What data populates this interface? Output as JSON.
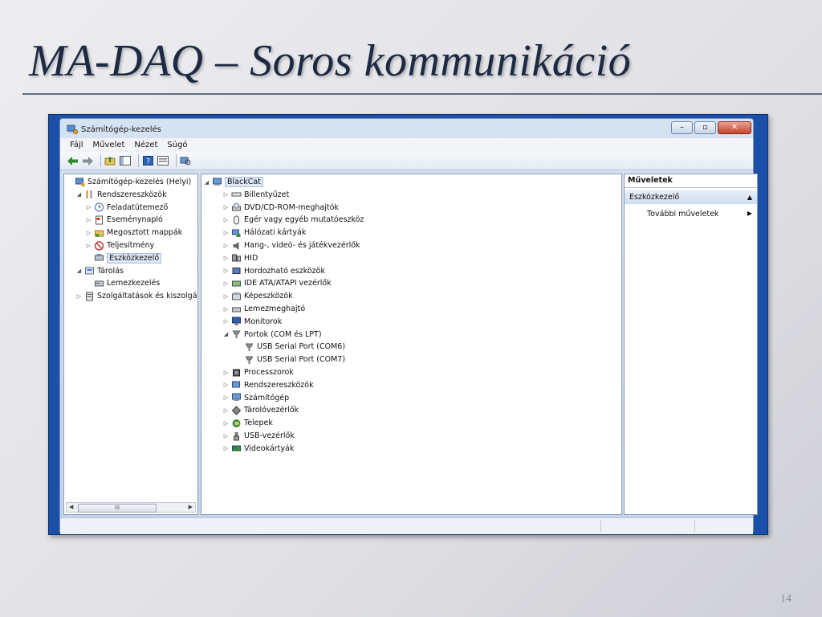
{
  "slide": {
    "title": "MA-DAQ – Soros kommunikáció",
    "page_number": "14"
  },
  "window": {
    "title": "Számítógép-kezelés",
    "buttons": {
      "minimize_icon": "minimize-icon",
      "maximize_icon": "maximize-icon",
      "close_icon": "close-icon"
    }
  },
  "menu": {
    "items": [
      "Fájl",
      "Művelet",
      "Nézet",
      "Súgó"
    ]
  },
  "toolbar": {
    "icons": [
      "back-arrow-icon",
      "forward-arrow-icon",
      "folder-up-icon",
      "console-tree-icon",
      "help-icon",
      "properties-icon",
      "scan-hardware-icon"
    ]
  },
  "left_tree": {
    "items": [
      {
        "label": "Számítógép-kezelés (Helyi)",
        "level": 0,
        "expander": "",
        "icon": "computer-management-icon"
      },
      {
        "label": "Rendszereszközök",
        "level": 1,
        "expander": "expanded",
        "icon": "tools-icon"
      },
      {
        "label": "Feladatütemező",
        "level": 2,
        "expander": "collapsed",
        "icon": "clock-icon"
      },
      {
        "label": "Eseménynapló",
        "level": 2,
        "expander": "collapsed",
        "icon": "event-log-icon"
      },
      {
        "label": "Megosztott mappák",
        "level": 2,
        "expander": "collapsed",
        "icon": "shared-folder-icon"
      },
      {
        "label": "Teljesítmény",
        "level": 2,
        "expander": "collapsed",
        "icon": "performance-icon"
      },
      {
        "label": "Eszközkezelő",
        "level": 2,
        "expander": "",
        "icon": "device-manager-icon",
        "selected": true
      },
      {
        "label": "Tárolás",
        "level": 1,
        "expander": "expanded",
        "icon": "storage-icon"
      },
      {
        "label": "Lemezkezelés",
        "level": 2,
        "expander": "",
        "icon": "disk-management-icon"
      },
      {
        "label": "Szolgáltatások és kiszolgáló",
        "level": 1,
        "expander": "collapsed",
        "icon": "services-icon"
      }
    ]
  },
  "device_tree": {
    "root": {
      "label": "BlackCat",
      "icon": "computer-icon"
    },
    "items": [
      {
        "label": "Billentyűzet",
        "level": 1,
        "expander": "collapsed",
        "icon": "keyboard-icon"
      },
      {
        "label": "DVD/CD-ROM-meghajtók",
        "level": 1,
        "expander": "collapsed",
        "icon": "dvd-drive-icon"
      },
      {
        "label": "Egér vagy egyéb mutatóeszköz",
        "level": 1,
        "expander": "collapsed",
        "icon": "mouse-icon"
      },
      {
        "label": "Hálózati kártyák",
        "level": 1,
        "expander": "collapsed",
        "icon": "network-adapter-icon"
      },
      {
        "label": "Hang-, videó- és játékvezérlők",
        "level": 1,
        "expander": "collapsed",
        "icon": "speaker-icon"
      },
      {
        "label": "HID",
        "level": 1,
        "expander": "collapsed",
        "icon": "hid-icon"
      },
      {
        "label": "Hordozható eszközök",
        "level": 1,
        "expander": "collapsed",
        "icon": "portable-device-icon"
      },
      {
        "label": "IDE ATA/ATAPI vezérlők",
        "level": 1,
        "expander": "collapsed",
        "icon": "ide-controller-icon"
      },
      {
        "label": "Képeszközök",
        "level": 1,
        "expander": "collapsed",
        "icon": "imaging-device-icon"
      },
      {
        "label": "Lemezmeghajtó",
        "level": 1,
        "expander": "collapsed",
        "icon": "disk-drive-icon"
      },
      {
        "label": "Monitorok",
        "level": 1,
        "expander": "collapsed",
        "icon": "monitor-icon"
      },
      {
        "label": "Portok (COM és LPT)",
        "level": 1,
        "expander": "expanded",
        "icon": "port-icon"
      },
      {
        "label": "USB Serial Port (COM6)",
        "level": 2,
        "expander": "",
        "icon": "port-icon"
      },
      {
        "label": "USB Serial Port (COM7)",
        "level": 2,
        "expander": "",
        "icon": "port-icon"
      },
      {
        "label": "Processzorok",
        "level": 1,
        "expander": "collapsed",
        "icon": "processor-icon"
      },
      {
        "label": "Rendszereszközök",
        "level": 1,
        "expander": "collapsed",
        "icon": "system-device-icon"
      },
      {
        "label": "Számítógép",
        "level": 1,
        "expander": "collapsed",
        "icon": "computer-icon"
      },
      {
        "label": "Tárolóvezérlők",
        "level": 1,
        "expander": "collapsed",
        "icon": "storage-controller-icon"
      },
      {
        "label": "Telepek",
        "level": 1,
        "expander": "collapsed",
        "icon": "battery-icon"
      },
      {
        "label": "USB-vezérlők",
        "level": 1,
        "expander": "collapsed",
        "icon": "usb-icon"
      },
      {
        "label": "Videokártyák",
        "level": 1,
        "expander": "collapsed",
        "icon": "display-adapter-icon"
      }
    ]
  },
  "actions": {
    "header": "Műveletek",
    "section": "Eszközkezelő",
    "more": "További műveletek"
  },
  "scrollbar": {
    "thumb_label": "III"
  }
}
